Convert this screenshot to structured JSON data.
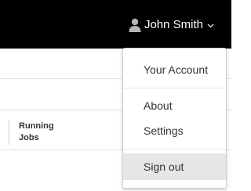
{
  "header": {
    "user_name": "John Smith",
    "user_icon": "user-icon",
    "chevron_icon": "chevron-down-icon"
  },
  "table": {
    "columns": [
      {
        "label_line1": "Running",
        "label_line2": "Jobs"
      }
    ]
  },
  "user_menu": {
    "items": [
      {
        "label": "Your Account",
        "highlighted": false
      },
      {
        "label": "About",
        "highlighted": false
      },
      {
        "label": "Settings",
        "highlighted": false
      },
      {
        "label": "Sign out",
        "highlighted": true
      }
    ]
  },
  "colors": {
    "topbar": "#000000",
    "header_text": "#ffffff",
    "menu_text": "#333333",
    "menu_hover": "#e6e6e6"
  }
}
